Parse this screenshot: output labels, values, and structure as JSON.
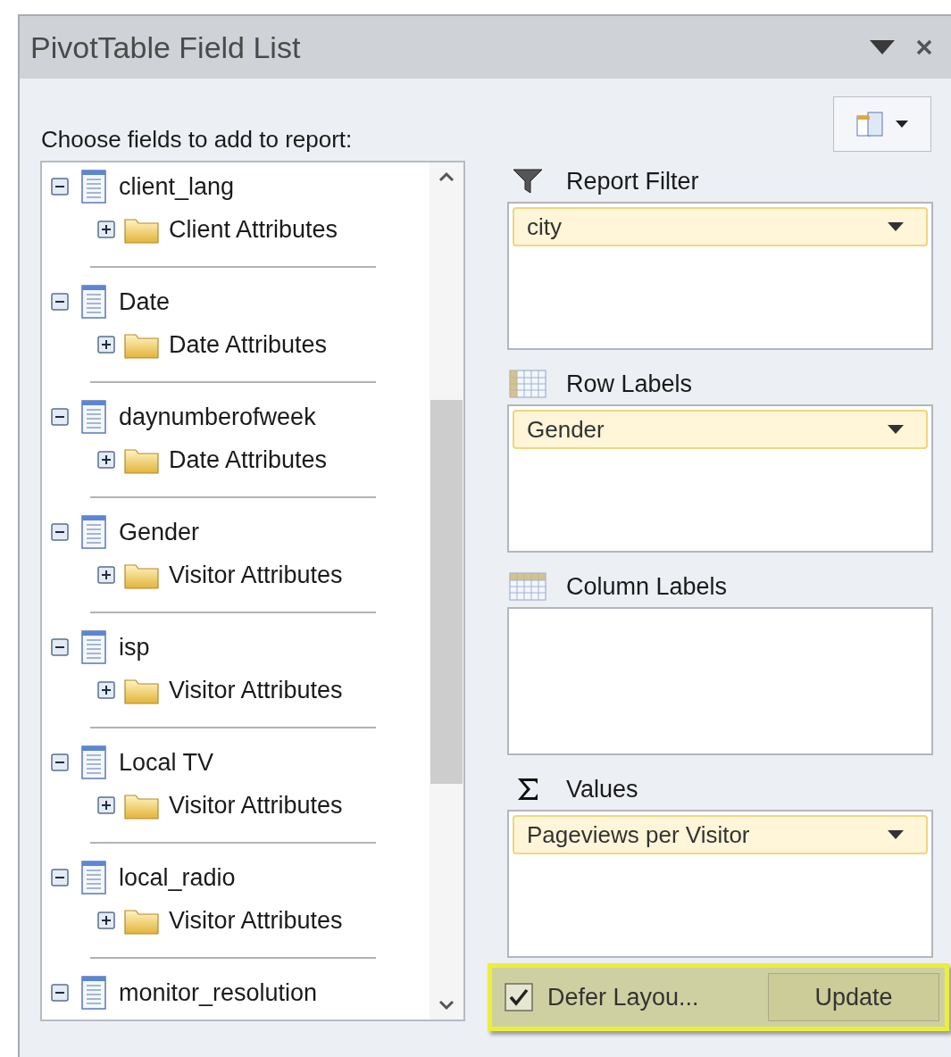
{
  "window": {
    "title": "PivotTable Field List"
  },
  "choose_label": "Choose fields to add to report:",
  "fields": [
    {
      "name": "client_lang",
      "expanded": true,
      "children": [
        {
          "name": "Client Attributes",
          "expanded": false
        }
      ]
    },
    {
      "name": "Date",
      "expanded": true,
      "children": [
        {
          "name": "Date Attributes",
          "expanded": false
        }
      ]
    },
    {
      "name": "daynumberofweek",
      "expanded": true,
      "children": [
        {
          "name": "Date Attributes",
          "expanded": false
        }
      ]
    },
    {
      "name": "Gender",
      "expanded": true,
      "children": [
        {
          "name": "Visitor Attributes",
          "expanded": false
        }
      ]
    },
    {
      "name": "isp",
      "expanded": true,
      "children": [
        {
          "name": "Visitor Attributes",
          "expanded": false
        }
      ]
    },
    {
      "name": "Local TV",
      "expanded": true,
      "children": [
        {
          "name": "Visitor Attributes",
          "expanded": false
        }
      ]
    },
    {
      "name": "local_radio",
      "expanded": true,
      "children": [
        {
          "name": "Visitor Attributes",
          "expanded": false
        }
      ]
    },
    {
      "name": "monitor_resolution",
      "expanded": true
    }
  ],
  "areas": [
    {
      "kind": "filter",
      "title": "Report Filter",
      "items": [
        "city"
      ]
    },
    {
      "kind": "rows",
      "title": "Row Labels",
      "items": [
        "Gender"
      ]
    },
    {
      "kind": "columns",
      "title": "Column Labels"
    },
    {
      "kind": "values",
      "title": "Values",
      "items": [
        "Pageviews per Visitor"
      ]
    }
  ],
  "defer_layout": {
    "label": "Defer Layou...",
    "checked": true
  },
  "update_button": "Update"
}
